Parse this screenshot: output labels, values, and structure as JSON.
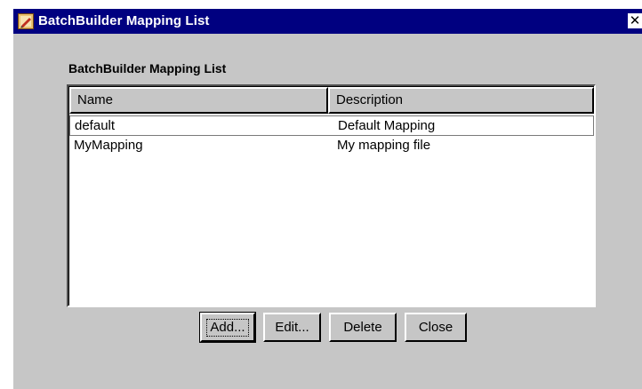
{
  "window": {
    "title": "BatchBuilder Mapping List",
    "close_glyph": "✕",
    "icon": "app-icon"
  },
  "panel": {
    "label": "BatchBuilder Mapping List"
  },
  "table": {
    "columns": [
      "Name",
      "Description"
    ],
    "rows": [
      {
        "name": "default",
        "description": "Default Mapping",
        "selected": true
      },
      {
        "name": "MyMapping",
        "description": "My mapping file",
        "selected": false
      }
    ]
  },
  "buttons": {
    "add": "Add...",
    "edit": "Edit...",
    "delete": "Delete",
    "close": "Close"
  },
  "colors": {
    "titlebar": "#000080",
    "window_bg": "#c6c6c6",
    "table_bg": "#ffffff"
  }
}
